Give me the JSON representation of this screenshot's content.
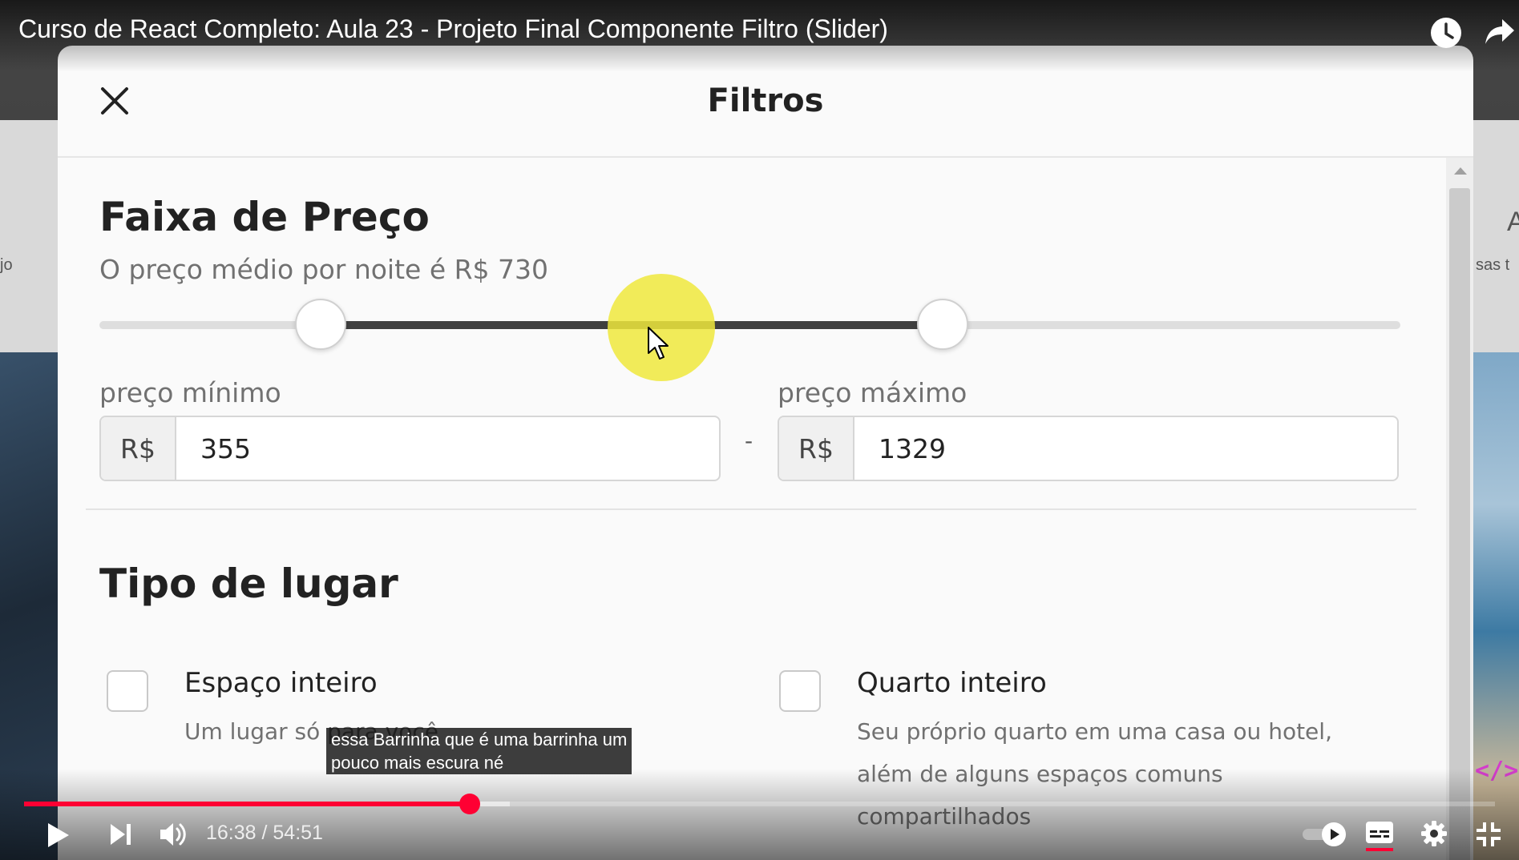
{
  "video": {
    "title": "Curso de React Completo: Aula 23 - Projeto Final Componente Filtro (Slider)",
    "watch_later_icon": "clock-icon",
    "share_icon": "share-arrow-icon",
    "background_left_text": "jo",
    "background_right_text": "sas t",
    "background_right_letter": "A"
  },
  "modal": {
    "title": "Filtros",
    "close_icon": "close-icon"
  },
  "price_section": {
    "title": "Faixa de Preço",
    "subtitle": "O preço médio por noite é R$ 730",
    "slider_min_fraction": 0.17,
    "slider_max_fraction": 0.648,
    "min_label": "preço mínimo",
    "max_label": "preço máximo",
    "currency": "R$",
    "min_value": "355",
    "max_value": "1329",
    "separator": "-"
  },
  "place_type": {
    "title": "Tipo de lugar",
    "options": [
      {
        "title": "Espaço inteiro",
        "description": "Um lugar só para você"
      },
      {
        "title": "Quarto inteiro",
        "description": "Seu próprio quarto em uma casa ou hotel, além de alguns espaços comuns compartilhados"
      }
    ]
  },
  "caption": {
    "line1": "essa Barrinha que é uma barrinha um",
    "line2": "pouco mais escura né"
  },
  "code_badge": "</>",
  "player": {
    "current_time": "16:38",
    "duration": "54:51",
    "time_display": "16:38 / 54:51",
    "played_fraction": 0.303,
    "buffered_fraction": 0.33,
    "play_icon": "play-icon",
    "next_icon": "next-icon",
    "volume_icon": "volume-icon",
    "autoplay_icon": "autoplay-toggle-icon",
    "subtitles_icon": "subtitles-icon",
    "settings_icon": "settings-gear-icon",
    "exit_fullscreen_icon": "exit-fullscreen-icon",
    "accent_color": "#ff0033"
  }
}
